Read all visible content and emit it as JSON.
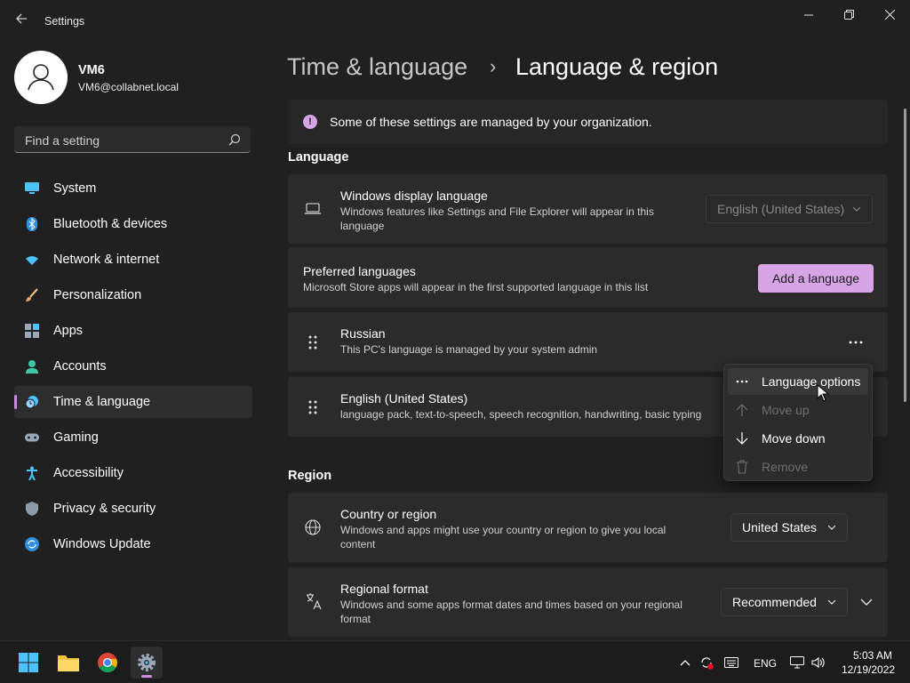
{
  "window": {
    "title": "Settings",
    "buttons": {
      "minimize": "minimize-icon",
      "maximize": "restore-icon",
      "close": "close-icon"
    }
  },
  "user": {
    "name": "VM6",
    "email": "VM6@collabnet.local"
  },
  "search": {
    "placeholder": "Find a setting"
  },
  "sidebar": {
    "items": [
      {
        "label": "System",
        "icon": "system-icon"
      },
      {
        "label": "Bluetooth & devices",
        "icon": "bluetooth-icon"
      },
      {
        "label": "Network & internet",
        "icon": "network-icon"
      },
      {
        "label": "Personalization",
        "icon": "brush-icon"
      },
      {
        "label": "Apps",
        "icon": "apps-icon"
      },
      {
        "label": "Accounts",
        "icon": "accounts-icon"
      },
      {
        "label": "Time & language",
        "icon": "time-language-icon",
        "active": true
      },
      {
        "label": "Gaming",
        "icon": "gaming-icon"
      },
      {
        "label": "Accessibility",
        "icon": "accessibility-icon"
      },
      {
        "label": "Privacy & security",
        "icon": "shield-icon"
      },
      {
        "label": "Windows Update",
        "icon": "update-icon"
      }
    ]
  },
  "breadcrumb": {
    "parent": "Time & language",
    "separator": "›",
    "current": "Language & region"
  },
  "banner": {
    "text": "Some of these settings are managed by your organization."
  },
  "language": {
    "heading": "Language",
    "display_language": {
      "title": "Windows display language",
      "subtitle": "Windows features like Settings and File Explorer will appear in this language",
      "value": "English (United States)"
    },
    "preferred": {
      "title": "Preferred languages",
      "subtitle": "Microsoft Store apps will appear in the first supported language in this list",
      "button": "Add a language"
    },
    "list": [
      {
        "name": "Russian",
        "detail": "This PC's language is managed by your system admin"
      },
      {
        "name": "English (United States)",
        "detail": "language pack, text-to-speech, speech recognition, handwriting, basic typing"
      }
    ]
  },
  "context_menu": {
    "items": [
      {
        "label": "Language options",
        "icon": "more-icon",
        "enabled": true
      },
      {
        "label": "Move up",
        "icon": "arrow-up-icon",
        "enabled": false
      },
      {
        "label": "Move down",
        "icon": "arrow-down-icon",
        "enabled": true
      },
      {
        "label": "Remove",
        "icon": "trash-icon",
        "enabled": false
      }
    ]
  },
  "region": {
    "heading": "Region",
    "country": {
      "title": "Country or region",
      "subtitle": "Windows and apps might use your country or region to give you local content",
      "value": "United States"
    },
    "format": {
      "title": "Regional format",
      "subtitle": "Windows and some apps format dates and times based on your regional format",
      "value": "Recommended"
    }
  },
  "taskbar": {
    "tray": {
      "language": "ENG",
      "time": "5:03 AM",
      "date": "12/19/2022"
    }
  },
  "colors": {
    "accent": "#d7a5e6",
    "background": "#202020",
    "card": "#2b2b2b"
  }
}
